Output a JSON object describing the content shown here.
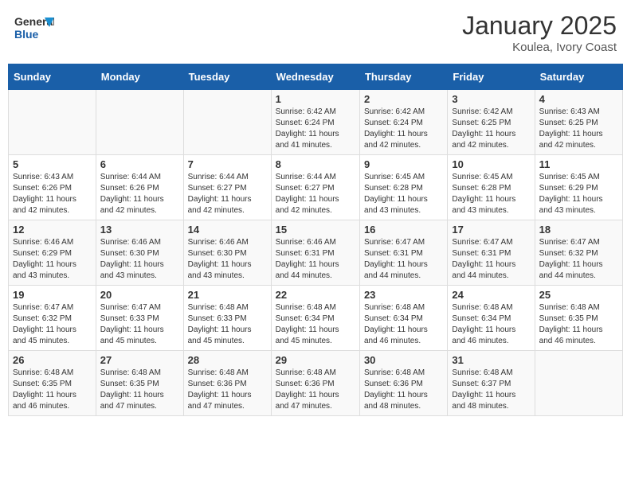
{
  "header": {
    "logo_general": "General",
    "logo_blue": "Blue",
    "month_title": "January 2025",
    "location": "Koulea, Ivory Coast"
  },
  "days_of_week": [
    "Sunday",
    "Monday",
    "Tuesday",
    "Wednesday",
    "Thursday",
    "Friday",
    "Saturday"
  ],
  "weeks": [
    [
      {
        "day": "",
        "info": ""
      },
      {
        "day": "",
        "info": ""
      },
      {
        "day": "",
        "info": ""
      },
      {
        "day": "1",
        "info": "Sunrise: 6:42 AM\nSunset: 6:24 PM\nDaylight: 11 hours\nand 41 minutes."
      },
      {
        "day": "2",
        "info": "Sunrise: 6:42 AM\nSunset: 6:24 PM\nDaylight: 11 hours\nand 42 minutes."
      },
      {
        "day": "3",
        "info": "Sunrise: 6:42 AM\nSunset: 6:25 PM\nDaylight: 11 hours\nand 42 minutes."
      },
      {
        "day": "4",
        "info": "Sunrise: 6:43 AM\nSunset: 6:25 PM\nDaylight: 11 hours\nand 42 minutes."
      }
    ],
    [
      {
        "day": "5",
        "info": "Sunrise: 6:43 AM\nSunset: 6:26 PM\nDaylight: 11 hours\nand 42 minutes."
      },
      {
        "day": "6",
        "info": "Sunrise: 6:44 AM\nSunset: 6:26 PM\nDaylight: 11 hours\nand 42 minutes."
      },
      {
        "day": "7",
        "info": "Sunrise: 6:44 AM\nSunset: 6:27 PM\nDaylight: 11 hours\nand 42 minutes."
      },
      {
        "day": "8",
        "info": "Sunrise: 6:44 AM\nSunset: 6:27 PM\nDaylight: 11 hours\nand 42 minutes."
      },
      {
        "day": "9",
        "info": "Sunrise: 6:45 AM\nSunset: 6:28 PM\nDaylight: 11 hours\nand 43 minutes."
      },
      {
        "day": "10",
        "info": "Sunrise: 6:45 AM\nSunset: 6:28 PM\nDaylight: 11 hours\nand 43 minutes."
      },
      {
        "day": "11",
        "info": "Sunrise: 6:45 AM\nSunset: 6:29 PM\nDaylight: 11 hours\nand 43 minutes."
      }
    ],
    [
      {
        "day": "12",
        "info": "Sunrise: 6:46 AM\nSunset: 6:29 PM\nDaylight: 11 hours\nand 43 minutes."
      },
      {
        "day": "13",
        "info": "Sunrise: 6:46 AM\nSunset: 6:30 PM\nDaylight: 11 hours\nand 43 minutes."
      },
      {
        "day": "14",
        "info": "Sunrise: 6:46 AM\nSunset: 6:30 PM\nDaylight: 11 hours\nand 43 minutes."
      },
      {
        "day": "15",
        "info": "Sunrise: 6:46 AM\nSunset: 6:31 PM\nDaylight: 11 hours\nand 44 minutes."
      },
      {
        "day": "16",
        "info": "Sunrise: 6:47 AM\nSunset: 6:31 PM\nDaylight: 11 hours\nand 44 minutes."
      },
      {
        "day": "17",
        "info": "Sunrise: 6:47 AM\nSunset: 6:31 PM\nDaylight: 11 hours\nand 44 minutes."
      },
      {
        "day": "18",
        "info": "Sunrise: 6:47 AM\nSunset: 6:32 PM\nDaylight: 11 hours\nand 44 minutes."
      }
    ],
    [
      {
        "day": "19",
        "info": "Sunrise: 6:47 AM\nSunset: 6:32 PM\nDaylight: 11 hours\nand 45 minutes."
      },
      {
        "day": "20",
        "info": "Sunrise: 6:47 AM\nSunset: 6:33 PM\nDaylight: 11 hours\nand 45 minutes."
      },
      {
        "day": "21",
        "info": "Sunrise: 6:48 AM\nSunset: 6:33 PM\nDaylight: 11 hours\nand 45 minutes."
      },
      {
        "day": "22",
        "info": "Sunrise: 6:48 AM\nSunset: 6:34 PM\nDaylight: 11 hours\nand 45 minutes."
      },
      {
        "day": "23",
        "info": "Sunrise: 6:48 AM\nSunset: 6:34 PM\nDaylight: 11 hours\nand 46 minutes."
      },
      {
        "day": "24",
        "info": "Sunrise: 6:48 AM\nSunset: 6:34 PM\nDaylight: 11 hours\nand 46 minutes."
      },
      {
        "day": "25",
        "info": "Sunrise: 6:48 AM\nSunset: 6:35 PM\nDaylight: 11 hours\nand 46 minutes."
      }
    ],
    [
      {
        "day": "26",
        "info": "Sunrise: 6:48 AM\nSunset: 6:35 PM\nDaylight: 11 hours\nand 46 minutes."
      },
      {
        "day": "27",
        "info": "Sunrise: 6:48 AM\nSunset: 6:35 PM\nDaylight: 11 hours\nand 47 minutes."
      },
      {
        "day": "28",
        "info": "Sunrise: 6:48 AM\nSunset: 6:36 PM\nDaylight: 11 hours\nand 47 minutes."
      },
      {
        "day": "29",
        "info": "Sunrise: 6:48 AM\nSunset: 6:36 PM\nDaylight: 11 hours\nand 47 minutes."
      },
      {
        "day": "30",
        "info": "Sunrise: 6:48 AM\nSunset: 6:36 PM\nDaylight: 11 hours\nand 48 minutes."
      },
      {
        "day": "31",
        "info": "Sunrise: 6:48 AM\nSunset: 6:37 PM\nDaylight: 11 hours\nand 48 minutes."
      },
      {
        "day": "",
        "info": ""
      }
    ]
  ]
}
